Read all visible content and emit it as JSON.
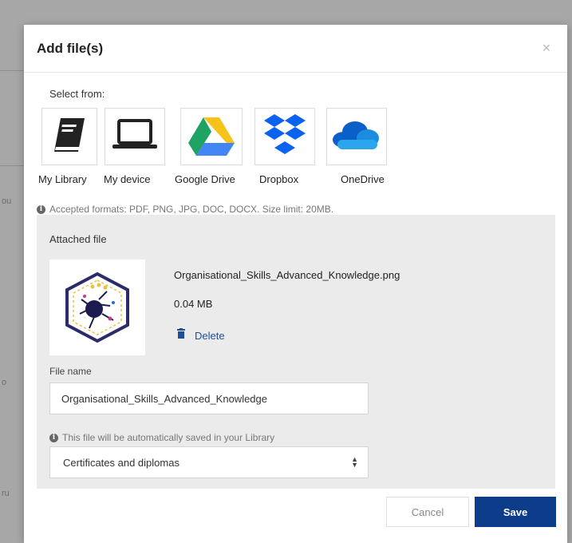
{
  "background": {
    "fragments": [
      "ou",
      "o",
      "ru"
    ]
  },
  "modal": {
    "title": "Add file(s)",
    "close_symbol": "×"
  },
  "select_from": {
    "label": "Select from:",
    "sources": [
      {
        "label": "My Library",
        "icon": "library-book-icon"
      },
      {
        "label": "My device",
        "icon": "laptop-icon"
      },
      {
        "label": "Google Drive",
        "icon": "google-drive-icon"
      },
      {
        "label": "Dropbox",
        "icon": "dropbox-icon"
      },
      {
        "label": "OneDrive",
        "icon": "onedrive-icon"
      }
    ]
  },
  "accepted_formats": "Accepted formats: PDF, PNG, JPG, DOC, DOCX. Size limit: 20MB.",
  "attached": {
    "title": "Attached file",
    "file_title": "Organisational_Skills_Advanced_Knowledge.png",
    "file_size": "0.04 MB",
    "delete_label": "Delete",
    "file_name_label": "File name",
    "file_name_value": "Organisational_Skills_Advanced_Knowledge",
    "save_note": "This file will be automatically saved in your Library",
    "category_selected": "Certificates and diplomas"
  },
  "footer": {
    "cancel_label": "Cancel",
    "save_label": "Save"
  },
  "colors": {
    "primary": "#0d3d8a",
    "link": "#1f4f96",
    "panel": "#ebebeb",
    "overlay": "#a7a7a7"
  }
}
